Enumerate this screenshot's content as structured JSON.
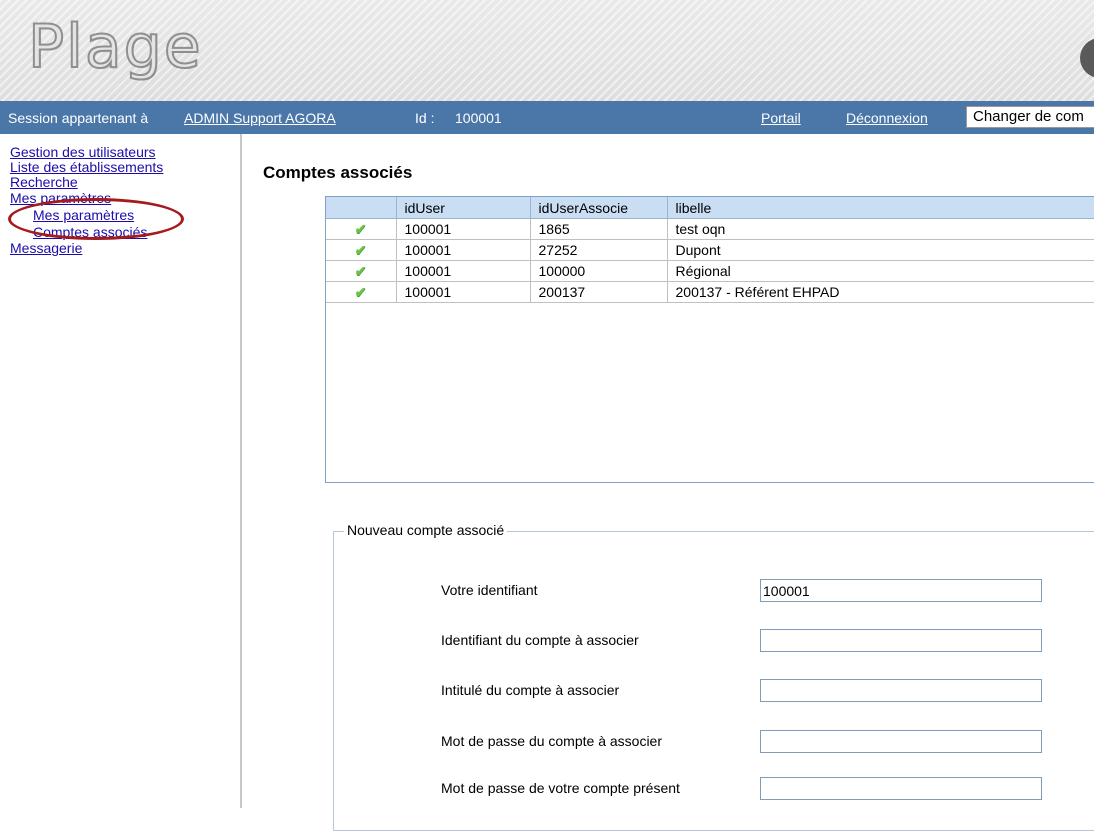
{
  "app": {
    "logo_text": "Plage"
  },
  "session": {
    "label": "Session appartenant à",
    "user_link": "ADMIN Support AGORA",
    "id_label": "Id :",
    "id_value": "100001",
    "portail": "Portail",
    "deconnexion": "Déconnexion",
    "change_account": "Changer de com"
  },
  "sidebar": {
    "items": [
      {
        "label": "Gestion des utilisateurs"
      },
      {
        "label": "Liste des établissements"
      },
      {
        "label": "Recherche"
      },
      {
        "label": "Mes paramètres"
      },
      {
        "label": "Mes paramètres"
      },
      {
        "label": "Comptes associés"
      },
      {
        "label": "Messagerie"
      }
    ]
  },
  "annotation_color": "#a51a1a",
  "main": {
    "title": "Comptes associés",
    "table": {
      "columns": [
        "",
        "idUser",
        "idUserAssocie",
        "libelle"
      ],
      "rows": [
        {
          "icon": "check-icon",
          "idUser": "100001",
          "idUserAssocie": "1865",
          "libelle": "test oqn"
        },
        {
          "icon": "check-icon",
          "idUser": "100001",
          "idUserAssocie": "27252",
          "libelle": "Dupont"
        },
        {
          "icon": "check-icon",
          "idUser": "100001",
          "idUserAssocie": "100000",
          "libelle": "Régional"
        },
        {
          "icon": "check-icon",
          "idUser": "100001",
          "idUserAssocie": "200137",
          "libelle": "200137 - Référent EHPAD"
        }
      ]
    },
    "form": {
      "legend": "Nouveau compte associé",
      "fields": [
        {
          "label": "Votre identifiant",
          "value": "100001"
        },
        {
          "label": "Identifiant du compte à associer",
          "value": ""
        },
        {
          "label": "Intitulé du compte à associer",
          "value": ""
        },
        {
          "label": "Mot de passe du compte à associer",
          "value": ""
        },
        {
          "label": "Mot de passe de votre compte présent",
          "value": ""
        }
      ]
    }
  }
}
